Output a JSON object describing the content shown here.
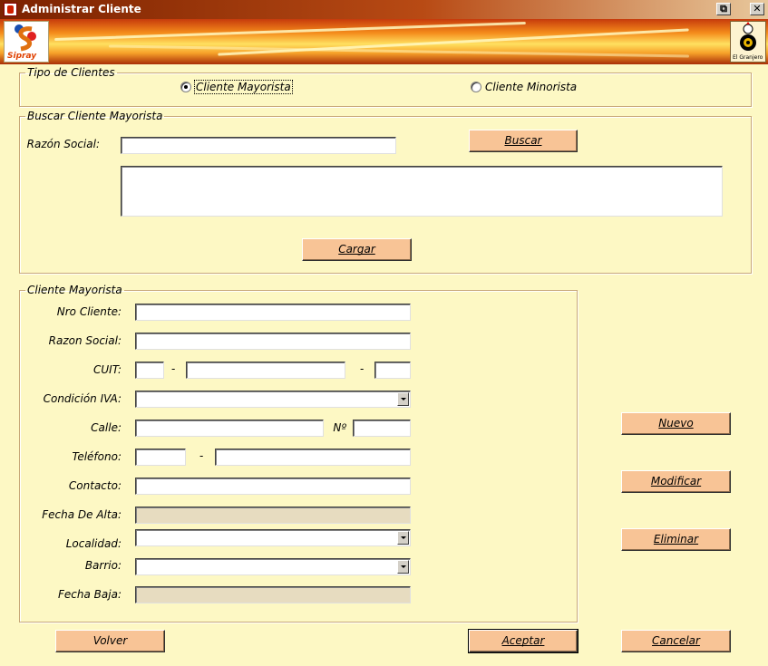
{
  "window": {
    "title": "Administrar Cliente",
    "restore_glyph": "⧉",
    "close_glyph": "✕"
  },
  "banner": {
    "left_logo_text": "Sipray",
    "right_logo_text": "El Granjero"
  },
  "tipo_clientes": {
    "legend": "Tipo de Clientes",
    "options": [
      {
        "label": "Cliente Mayorista",
        "checked": true
      },
      {
        "label": "Cliente Minorista",
        "checked": false
      }
    ]
  },
  "buscar": {
    "legend": "Buscar Cliente Mayorista",
    "razon_social_label": "Razón Social:",
    "razon_social_value": "",
    "buscar_button": "Buscar",
    "results": [],
    "cargar_button": "Cargar"
  },
  "cliente": {
    "legend": "Cliente Mayorista",
    "fields": {
      "nro_cliente": {
        "label": "Nro Cliente:",
        "value": ""
      },
      "razon_social": {
        "label": "Razon Social:",
        "value": ""
      },
      "cuit": {
        "label": "CUIT:",
        "part1": "",
        "part2": "",
        "part3": "",
        "sep": "-"
      },
      "condicion_iva": {
        "label": "Condición IVA:",
        "value": ""
      },
      "calle": {
        "label": "Calle:",
        "value": "",
        "numero_label": "Nº",
        "numero_value": ""
      },
      "telefono": {
        "label": "Teléfono:",
        "part1": "",
        "part2": "",
        "sep": "-"
      },
      "contacto": {
        "label": "Contacto:",
        "value": ""
      },
      "fecha_alta": {
        "label": "Fecha De Alta:",
        "value": ""
      },
      "localidad": {
        "label": "Localidad:",
        "value": ""
      },
      "barrio": {
        "label": "Barrio:",
        "value": ""
      },
      "fecha_baja": {
        "label": "Fecha Baja:",
        "value": ""
      }
    }
  },
  "actions": {
    "nuevo": "Nuevo",
    "modificar": "Modificar",
    "eliminar": "Eliminar",
    "volver": "Volver",
    "aceptar": "Aceptar",
    "cancelar": "Cancelar"
  },
  "colors": {
    "background": "#fdf8c4",
    "button": "#f8c496",
    "titlebar": "#7b2200"
  }
}
